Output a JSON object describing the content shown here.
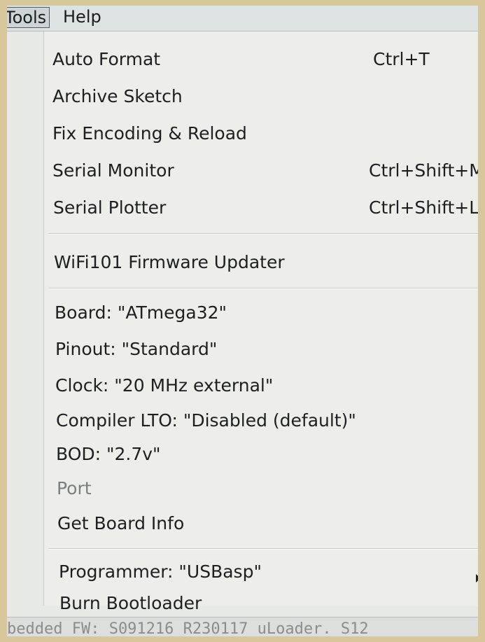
{
  "menubar": {
    "tools": "Tools",
    "help": "Help"
  },
  "menu": {
    "auto_format": {
      "label": "Auto Format",
      "shortcut": "Ctrl+T"
    },
    "archive_sketch": {
      "label": "Archive Sketch"
    },
    "fix_encoding": {
      "label": "Fix Encoding & Reload"
    },
    "serial_monitor": {
      "label": "Serial Monitor",
      "shortcut": "Ctrl+Shift+M"
    },
    "serial_plotter": {
      "label": "Serial Plotter",
      "shortcut": "Ctrl+Shift+L"
    },
    "wifi_updater": {
      "label": "WiFi101 Firmware Updater"
    },
    "board": {
      "label": "Board: \"ATmega32\""
    },
    "pinout": {
      "label": "Pinout: \"Standard\""
    },
    "clock": {
      "label": "Clock: \"20 MHz external\""
    },
    "compiler_lto": {
      "label": "Compiler LTO: \"Disabled (default)\""
    },
    "bod": {
      "label": "BOD: \"2.7v\""
    },
    "port": {
      "label": "Port"
    },
    "get_board_info": {
      "label": "Get Board Info"
    },
    "programmer": {
      "label": "Programmer: \"USBasp\""
    },
    "burn_bootloader": {
      "label": "Burn Bootloader"
    }
  },
  "console": {
    "text": "bedded FW: S091216 R230117 uLoader. S12"
  },
  "icons": {
    "submenu_arrow": "triangle-right"
  }
}
